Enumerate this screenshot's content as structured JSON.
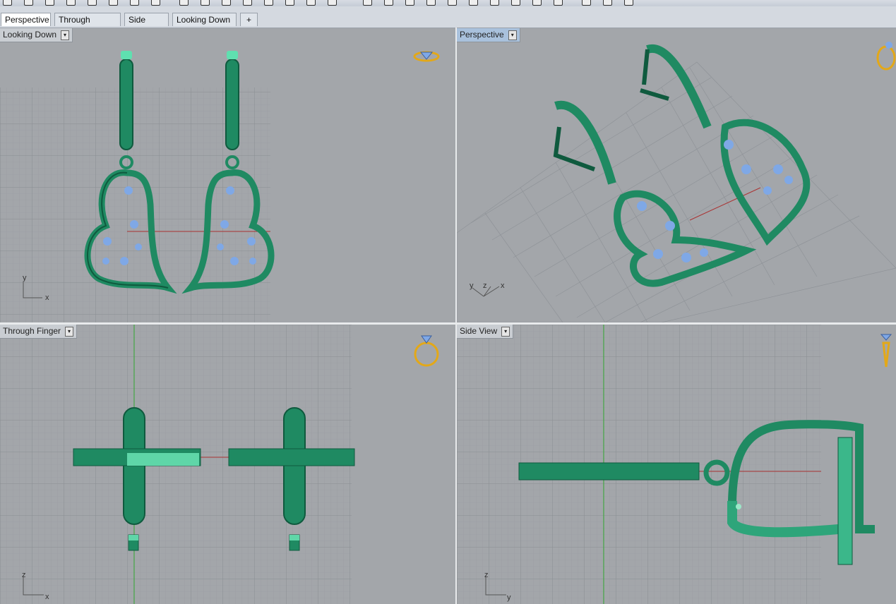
{
  "tabs": [
    {
      "label": "Perspective",
      "active": true
    },
    {
      "label": "Through Finger",
      "active": false
    },
    {
      "label": "Side View",
      "active": false
    },
    {
      "label": "Looking Down",
      "active": false
    }
  ],
  "tab_add_label": "+",
  "viewports": {
    "top_left": {
      "label": "Looking Down",
      "axes": [
        "y",
        "x"
      ],
      "widget_icon": "diamond-ring-icon"
    },
    "top_right": {
      "label": "Perspective",
      "axes": [
        "y",
        "z",
        "x"
      ],
      "widget_icon": "ring-perspective-icon"
    },
    "bottom_left": {
      "label": "Through Finger",
      "axes": [
        "z",
        "x"
      ],
      "widget_icon": "ring-front-icon"
    },
    "bottom_right": {
      "label": "Side View",
      "axes": [
        "z",
        "y"
      ],
      "widget_icon": "ring-side-icon"
    }
  },
  "colors": {
    "model": "#1f8a62",
    "model_dark": "#0f5a3e",
    "gem": "#7fa8e6",
    "grid": "#8f9398",
    "axis_red": "#a33",
    "axis_green": "#3a3",
    "widget_gold": "#e3a818",
    "active_label": "#a9c1dc"
  }
}
